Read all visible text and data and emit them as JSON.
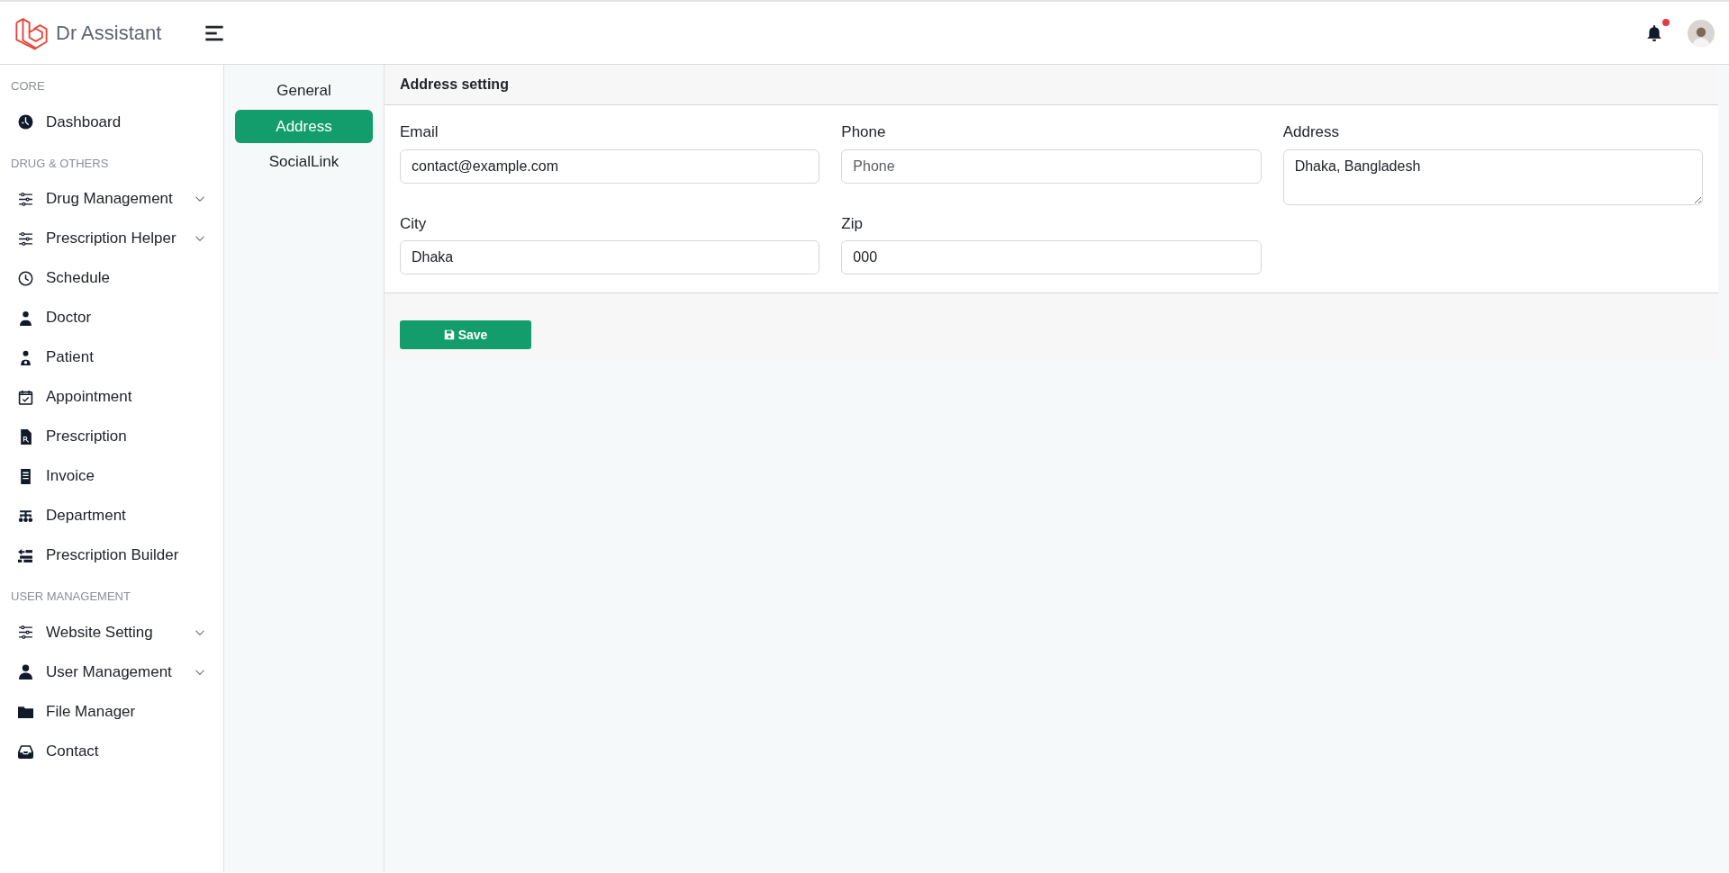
{
  "brand": {
    "name": "Dr Assistant"
  },
  "notifications": {
    "unread": true
  },
  "sidebar": {
    "sections": [
      {
        "heading": "CORE",
        "items": [
          {
            "label": "Dashboard",
            "expandable": false
          }
        ]
      },
      {
        "heading": "DRUG & OTHERS",
        "items": [
          {
            "label": "Drug Management",
            "expandable": true
          },
          {
            "label": "Prescription Helper",
            "expandable": true
          },
          {
            "label": "Schedule",
            "expandable": false
          },
          {
            "label": "Doctor",
            "expandable": false
          },
          {
            "label": "Patient",
            "expandable": false
          },
          {
            "label": "Appointment",
            "expandable": false
          },
          {
            "label": "Prescription",
            "expandable": false
          },
          {
            "label": "Invoice",
            "expandable": false
          },
          {
            "label": "Department",
            "expandable": false
          },
          {
            "label": "Prescription Builder",
            "expandable": false
          }
        ]
      },
      {
        "heading": "USER MANAGEMENT",
        "items": [
          {
            "label": "Website Setting",
            "expandable": true
          },
          {
            "label": "User Management",
            "expandable": true
          },
          {
            "label": "File Manager",
            "expandable": false
          },
          {
            "label": "Contact",
            "expandable": false
          }
        ]
      }
    ]
  },
  "tabs": [
    {
      "label": "General",
      "selected": false
    },
    {
      "label": "Address",
      "selected": true
    },
    {
      "label": "SocialLink",
      "selected": false
    }
  ],
  "card": {
    "title": "Address setting",
    "fields": [
      {
        "label": "Email",
        "kind": "input",
        "value": "contact@example.com"
      },
      {
        "label": "Phone",
        "kind": "input",
        "placeholder": "Phone"
      },
      {
        "label": "Address",
        "kind": "textarea",
        "value": "Dhaka, Bangladesh"
      },
      {
        "label": "City",
        "kind": "input",
        "value": "Dhaka"
      },
      {
        "label": "Zip",
        "kind": "input",
        "value": "000"
      }
    ],
    "save_button": "Save"
  }
}
